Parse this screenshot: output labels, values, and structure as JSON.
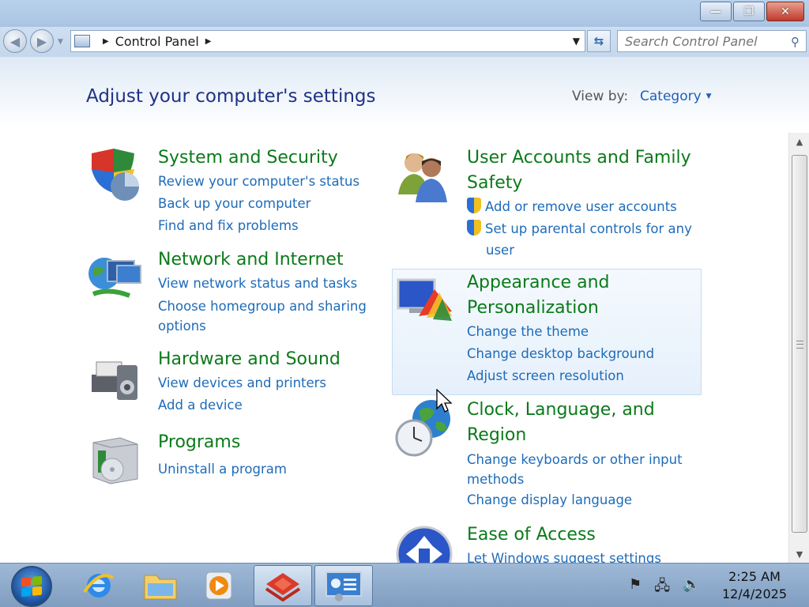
{
  "window": {
    "minimize_label": "—",
    "maximize_label": "❐",
    "close_label": "✕"
  },
  "nav": {
    "back_glyph": "◀",
    "forward_glyph": "▶",
    "breadcrumb": [
      "Control Panel"
    ],
    "search_placeholder": "Search Control Panel"
  },
  "header": {
    "title": "Adjust your computer's settings",
    "view_by_label": "View by:",
    "view_by_value": "Category"
  },
  "categories_left": [
    {
      "title": "System and Security",
      "links": [
        "Review your computer's status",
        "Back up your computer",
        "Find and fix problems"
      ]
    },
    {
      "title": "Network and Internet",
      "links": [
        "View network status and tasks",
        "Choose homegroup and sharing",
        "options"
      ]
    },
    {
      "title": "Hardware and Sound",
      "links": [
        "View devices and printers",
        "Add a device"
      ]
    },
    {
      "title": "Programs",
      "links": [
        "Uninstall a program"
      ]
    }
  ],
  "categories_right": [
    {
      "title_line1": "User Accounts and Family",
      "title_line2": "Safety",
      "links": [
        "Add or remove user accounts",
        "Set up parental controls for any",
        "user"
      ]
    },
    {
      "title_line1": "Appearance and",
      "title_line2": "Personalization",
      "links": [
        "Change the theme",
        "Change desktop background",
        "Adjust screen resolution"
      ]
    },
    {
      "title_line1": "Clock, Language, and",
      "title_line2": "Region",
      "links": [
        "Change keyboards or other input",
        "methods",
        "Change display language"
      ]
    },
    {
      "title_line1": "Ease of Access",
      "links": [
        "Let Windows suggest settings"
      ]
    }
  ],
  "taskbar": {
    "time": "2:25 AM",
    "date": "12/4/2025"
  },
  "colors": {
    "category_title": "#0b7a1a",
    "link": "#1e6bb8",
    "heading": "#1e3287"
  }
}
